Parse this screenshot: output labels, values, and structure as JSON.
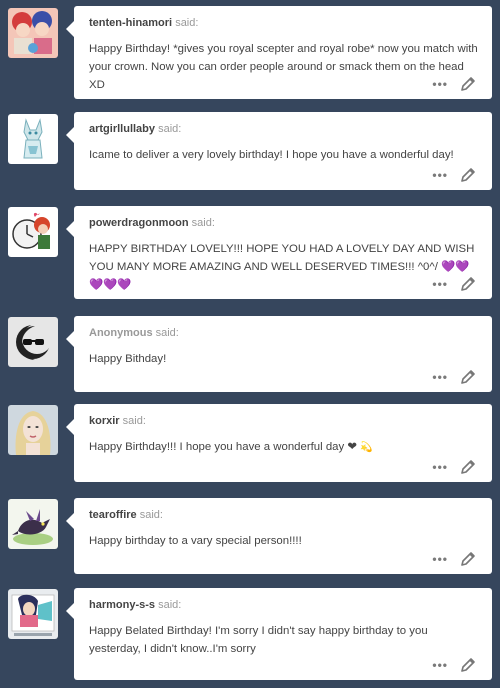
{
  "said_label": "said:",
  "asks": [
    {
      "asker": "tenten-hinamori",
      "question": "Happy Birthday! *gives you royal scepter and royal robe* now you match with your crown. Now you can order people around or smack them on the head XD",
      "avatar": "anime-girls-avatar"
    },
    {
      "asker": "artgirllullaby",
      "question": "Icame to deliver a very lovely birthday! I hope you have a wonderful day!",
      "avatar": "white-wolf-avatar"
    },
    {
      "asker": "powerdragonmoon",
      "question": "HAPPY BIRTHDAY LOVELY!!! HOPE YOU HAD A LOVELY DAY AND WISH YOU MANY MORE AMAZING AND WELL DESERVED TIMES!!! ^0^/",
      "emoji": "💜💜💜💜💜",
      "avatar": "clock-character-avatar"
    },
    {
      "asker": "Anonymous",
      "question": "Happy Bithday!",
      "avatar": "anonymous-sunglasses-avatar"
    },
    {
      "asker": "korxir",
      "question": "Happy Birthday!!! I hope you have a wonderful day ❤",
      "emoji": "💫",
      "avatar": "blonde-woman-avatar"
    },
    {
      "asker": "tearoffire",
      "question": "Happy birthday to a vary special person!!!!",
      "avatar": "dragon-avatar"
    },
    {
      "asker": "harmony-s-s",
      "question": "Happy Belated Birthday! I'm sorry I didn't say happy birthday to you yesterday, I didn't know..I'm sorry",
      "avatar": "anime-drawing-avatar"
    }
  ]
}
